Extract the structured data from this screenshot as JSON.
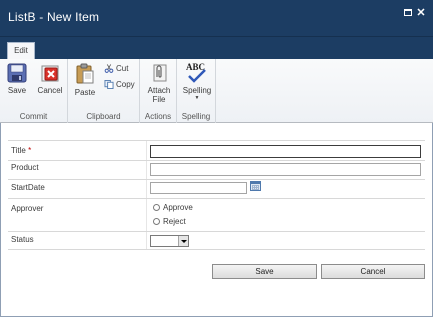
{
  "window": {
    "title": "ListB - New Item",
    "maximize_icon": "maximize-icon",
    "close_glyph": "✕"
  },
  "tabs": {
    "edit": "Edit"
  },
  "ribbon": {
    "commit": {
      "label": "Commit",
      "save": "Save",
      "cancel": "Cancel"
    },
    "clipboard": {
      "label": "Clipboard",
      "paste": "Paste",
      "cut": "Cut",
      "copy": "Copy"
    },
    "actions": {
      "label": "Actions",
      "attach_line1": "Attach",
      "attach_line2": "File"
    },
    "spelling": {
      "label": "Spelling",
      "button": "Spelling",
      "abc": "ABC"
    }
  },
  "form": {
    "title_label": "Title",
    "required_marker": "*",
    "product_label": "Product",
    "startdate_label": "StartDate",
    "approver_label": "Approver",
    "approver_options": [
      "Approve",
      "Reject"
    ],
    "status_label": "Status",
    "title_value": "",
    "product_value": "",
    "startdate_value": "",
    "status_value": ""
  },
  "buttons": {
    "save": "Save",
    "cancel": "Cancel"
  },
  "colors": {
    "titlebar": "#1c3d63",
    "required": "#bf0000"
  }
}
